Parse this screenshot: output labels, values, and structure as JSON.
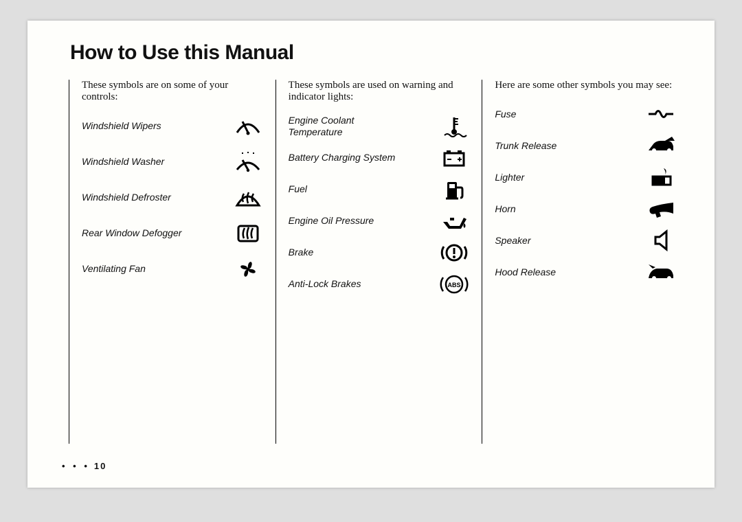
{
  "title": "How to Use this Manual",
  "page_number": "10",
  "columns": {
    "c1": {
      "intro": "These symbols are on some of your controls:",
      "items": [
        {
          "label": "Windshield Wipers",
          "icon": "wiper-icon"
        },
        {
          "label": "Windshield Washer",
          "icon": "washer-icon"
        },
        {
          "label": "Windshield Defroster",
          "icon": "defroster-icon"
        },
        {
          "label": "Rear Window Defogger",
          "icon": "rear-defogger-icon"
        },
        {
          "label": "Ventilating Fan",
          "icon": "fan-icon"
        }
      ]
    },
    "c2": {
      "intro": "These symbols are used on warning and indicator lights:",
      "items": [
        {
          "label": "Engine Coolant Temperature",
          "icon": "coolant-temp-icon"
        },
        {
          "label": "Battery Charging System",
          "icon": "battery-icon"
        },
        {
          "label": "Fuel",
          "icon": "fuel-icon"
        },
        {
          "label": "Engine Oil Pressure",
          "icon": "oil-icon"
        },
        {
          "label": "Brake",
          "icon": "brake-icon"
        },
        {
          "label": "Anti-Lock Brakes",
          "icon": "abs-icon"
        }
      ]
    },
    "c3": {
      "intro": "Here are some other symbols you may see:",
      "items": [
        {
          "label": "Fuse",
          "icon": "fuse-icon"
        },
        {
          "label": "Trunk Release",
          "icon": "trunk-release-icon"
        },
        {
          "label": "Lighter",
          "icon": "lighter-icon"
        },
        {
          "label": "Horn",
          "icon": "horn-icon"
        },
        {
          "label": "Speaker",
          "icon": "speaker-icon"
        },
        {
          "label": "Hood Release",
          "icon": "hood-release-icon"
        }
      ]
    }
  }
}
